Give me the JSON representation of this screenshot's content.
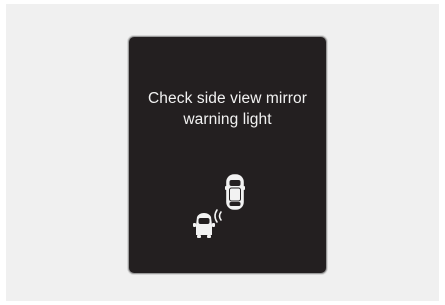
{
  "display": {
    "message_line1": "Check side view mirror",
    "message_line2": "warning light",
    "icon": "blind-spot-warning-icon",
    "background_color": "#231f20",
    "text_color": "#f2f2f2"
  }
}
